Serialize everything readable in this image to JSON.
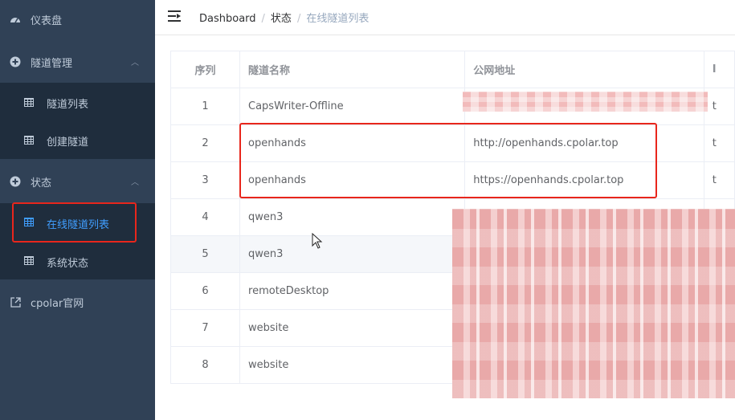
{
  "sidebar": {
    "items": [
      {
        "label": "仪表盘",
        "icon": "dashboard-icon"
      },
      {
        "label": "隧道管理",
        "icon": "plus-circle-icon",
        "expanded": true,
        "children": [
          {
            "label": "隧道列表"
          },
          {
            "label": "创建隧道"
          }
        ]
      },
      {
        "label": "状态",
        "icon": "plus-circle-icon",
        "expanded": true,
        "children": [
          {
            "label": "在线隧道列表",
            "active": true
          },
          {
            "label": "系统状态"
          }
        ]
      },
      {
        "label": "cpolar官网",
        "icon": "external-link-icon"
      }
    ]
  },
  "breadcrumb": [
    "Dashboard",
    "状态",
    "在线隧道列表"
  ],
  "table": {
    "headers": [
      "序列",
      "隧道名称",
      "公网地址",
      "I"
    ],
    "rows": [
      {
        "idx": "1",
        "name": "CapsWriter-Offline",
        "url": "",
        "extra": "t"
      },
      {
        "idx": "2",
        "name": "openhands",
        "url": "http://openhands.cpolar.top",
        "extra": "t"
      },
      {
        "idx": "3",
        "name": "openhands",
        "url": "https://openhands.cpolar.top",
        "extra": "t"
      },
      {
        "idx": "4",
        "name": "qwen3",
        "url": "",
        "extra": "t"
      },
      {
        "idx": "5",
        "name": "qwen3",
        "url": "",
        "extra": "t"
      },
      {
        "idx": "6",
        "name": "remoteDesktop",
        "url": "",
        "extra": "t"
      },
      {
        "idx": "7",
        "name": "website",
        "url": "",
        "extra": "t"
      },
      {
        "idx": "8",
        "name": "website",
        "url": "",
        "extra": "t"
      }
    ]
  },
  "colors": {
    "sidebar_bg": "#304156",
    "submenu_bg": "#1f2d3d",
    "active": "#409eff",
    "highlight_box": "#e8261c"
  }
}
